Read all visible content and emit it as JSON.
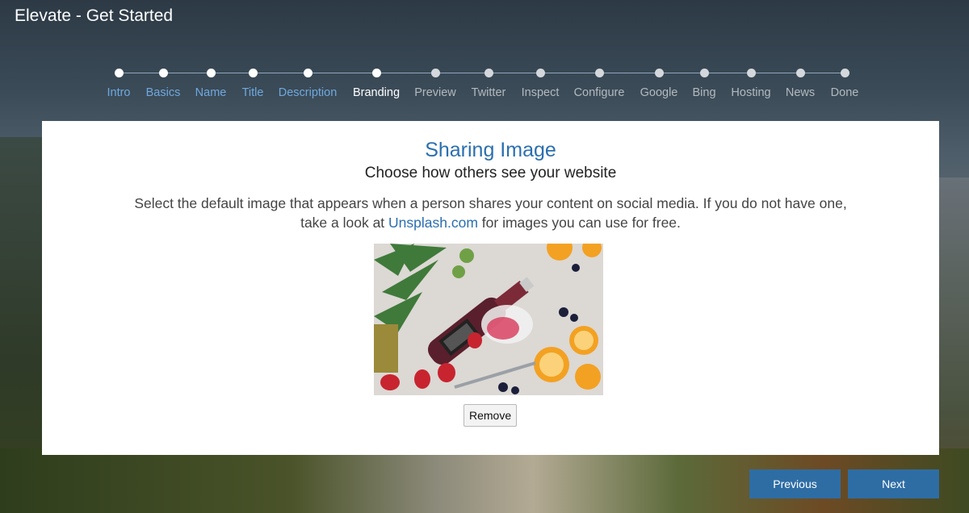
{
  "app": {
    "title": "Elevate - Get Started"
  },
  "steps": [
    {
      "label": "Intro",
      "state": "done"
    },
    {
      "label": "Basics",
      "state": "done"
    },
    {
      "label": "Name",
      "state": "done"
    },
    {
      "label": "Title",
      "state": "done"
    },
    {
      "label": "Description",
      "state": "done"
    },
    {
      "label": "Branding",
      "state": "current"
    },
    {
      "label": "Preview",
      "state": "pending"
    },
    {
      "label": "Twitter",
      "state": "pending"
    },
    {
      "label": "Inspect",
      "state": "pending"
    },
    {
      "label": "Configure",
      "state": "pending"
    },
    {
      "label": "Google",
      "state": "pending"
    },
    {
      "label": "Bing",
      "state": "pending"
    },
    {
      "label": "Hosting",
      "state": "pending"
    },
    {
      "label": "News",
      "state": "pending"
    },
    {
      "label": "Done",
      "state": "pending"
    }
  ],
  "panel": {
    "title": "Sharing Image",
    "subtitle": "Choose how others see your website",
    "description_before": "Select the default image that appears when a person shares your content on social media. If you do not have one, take a look at ",
    "link_text": "Unsplash.com",
    "description_after": " for images you can use for free.",
    "remove_label": "Remove"
  },
  "nav": {
    "previous_label": "Previous",
    "next_label": "Next"
  },
  "colors": {
    "accent": "#2e6da4",
    "title": "#2b6fae",
    "step_done": "#6fa9de",
    "step_current": "#ffffff",
    "step_pending": "#b4b9be"
  }
}
